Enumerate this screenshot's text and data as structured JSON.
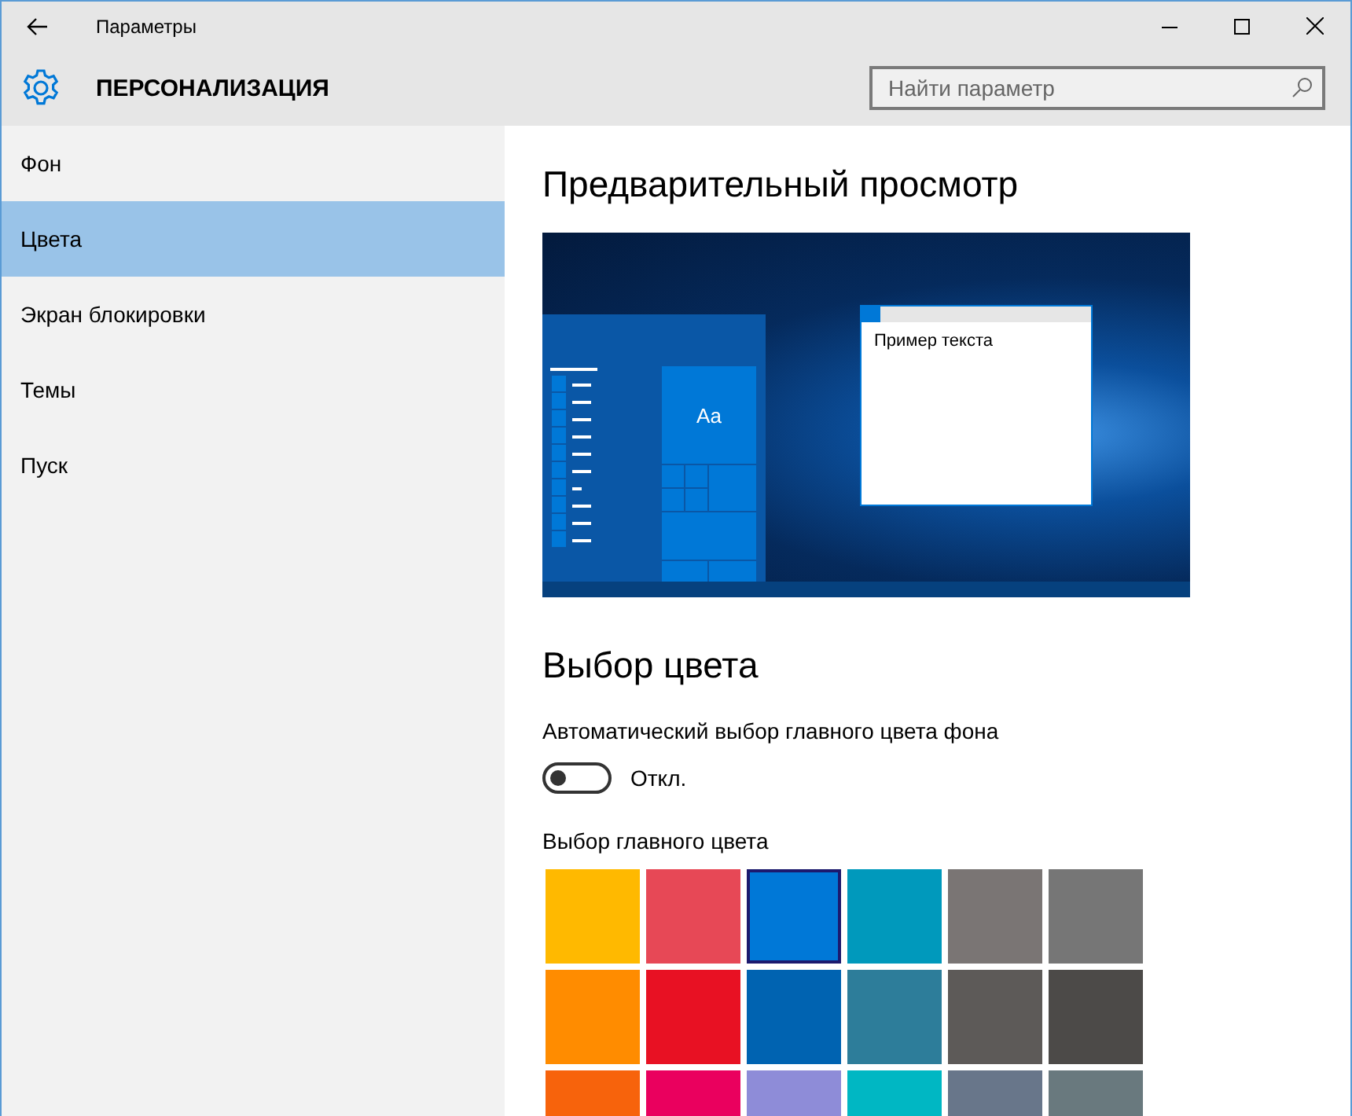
{
  "window": {
    "title": "Параметры"
  },
  "header": {
    "title": "ПЕРСОНАЛИЗАЦИЯ",
    "search": {
      "placeholder": "Найти параметр"
    }
  },
  "sidebar": {
    "items": [
      {
        "label": "Фон",
        "selected": false
      },
      {
        "label": "Цвета",
        "selected": true
      },
      {
        "label": "Экран блокировки",
        "selected": false
      },
      {
        "label": "Темы",
        "selected": false
      },
      {
        "label": "Пуск",
        "selected": false
      }
    ]
  },
  "preview": {
    "heading": "Предварительный просмотр",
    "tile_text": "Aa",
    "window_text": "Пример текста"
  },
  "colors": {
    "heading": "Выбор цвета",
    "auto_label": "Автоматический выбор главного цвета фона",
    "toggle": {
      "on": false,
      "state_text": "Откл."
    },
    "accent_label": "Выбор главного цвета",
    "swatches": [
      {
        "color": "#ffb900",
        "selected": false
      },
      {
        "color": "#e74856",
        "selected": false
      },
      {
        "color": "#0078d7",
        "selected": true
      },
      {
        "color": "#0099bc",
        "selected": false
      },
      {
        "color": "#7a7574",
        "selected": false
      },
      {
        "color": "#767676",
        "selected": false
      },
      {
        "color": "#ff8c00",
        "selected": false
      },
      {
        "color": "#e81123",
        "selected": false
      },
      {
        "color": "#0063b1",
        "selected": false
      },
      {
        "color": "#2d7d9a",
        "selected": false
      },
      {
        "color": "#5d5a58",
        "selected": false
      },
      {
        "color": "#4c4a48",
        "selected": false
      },
      {
        "color": "#f7630c",
        "selected": false
      },
      {
        "color": "#ea005e",
        "selected": false
      },
      {
        "color": "#8e8cd8",
        "selected": false
      },
      {
        "color": "#00b7c3",
        "selected": false
      },
      {
        "color": "#68768a",
        "selected": false
      },
      {
        "color": "#69797e",
        "selected": false
      }
    ]
  }
}
